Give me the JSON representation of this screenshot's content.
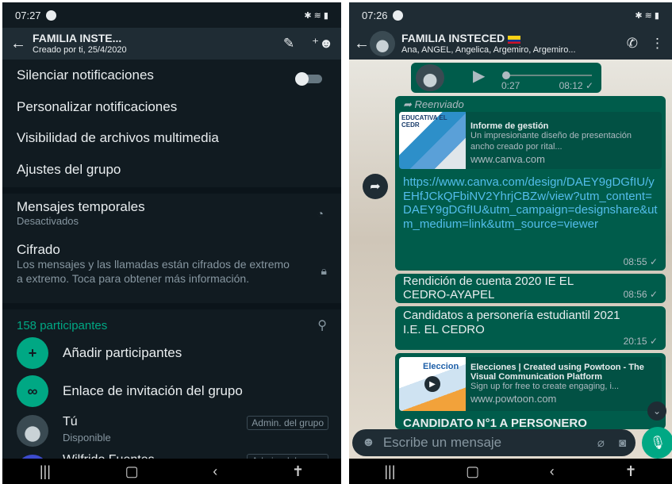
{
  "left": {
    "status": {
      "time": "07:27",
      "icons": "✱ ≋ ▮"
    },
    "header": {
      "title": "FAMILIA INSTE...",
      "subtitle": "Creado por ti, 25/4/2020"
    },
    "menu": {
      "mute": "Silenciar notificaciones",
      "custom_notifications": "Personalizar notificaciones",
      "media_visibility": "Visibilidad de archivos multimedia",
      "group_settings": "Ajustes del grupo",
      "disappearing_title": "Mensajes temporales",
      "disappearing_value": "Desactivados",
      "encryption_title": "Cifrado",
      "encryption_desc": "Los mensajes y las llamadas están cifrados de extremo a extremo. Toca para obtener más información."
    },
    "participants": {
      "count_label": "158 participantes",
      "add_label": "Añadir participantes",
      "invite_label": "Enlace de invitación del grupo",
      "members": [
        {
          "name": "Tú",
          "status": "Disponible",
          "badge": "Admin. del grupo"
        },
        {
          "name": "Wilfrido Fuentes",
          "status": "",
          "badge": "Admin. del grupo"
        }
      ]
    }
  },
  "right": {
    "status": {
      "time": "07:26",
      "icons": "✱ ≋ ▮"
    },
    "header": {
      "title": "FAMILIA INSTECED",
      "flag": "colombia-flag",
      "members": "Ana, ANGEL, Angelica, Argemiro, Argemiro..."
    },
    "voice": {
      "duration": "0:27",
      "time": "08:12 ✓"
    },
    "forwarded_label": "Reenviado",
    "link_msg": {
      "thumb_text": "EDUCATIVA EL CEDR",
      "preview_title": "Informe de gestión",
      "preview_desc": "Un impresionante diseño de presentación ancho creado por rital...",
      "preview_domain": "www.canva.com",
      "url": "https://www.canva.com/design/DAEY9gDGfIU/yEHfJCkQFbiNV2YhrjCBZw/view?utm_content=DAEY9gDGfIU&utm_campaign=designshare&utm_medium=link&utm_source=viewer",
      "time": "08:55 ✓"
    },
    "msg2": {
      "text": "Rendición de cuenta 2020 IE EL CEDRO-AYAPEL",
      "time": "08:56 ✓"
    },
    "msg3": {
      "text": "Candidatos a personería estudiantil 2021 I.E. EL CEDRO",
      "time": "20:15 ✓"
    },
    "msg4": {
      "thumb_text": "Eleccion",
      "preview_title": "Elecciones | Created using Powtoon - The Visual Communication Platform",
      "preview_desc": "Sign up for free to create engaging, i...",
      "preview_domain": "www.powtoon.com",
      "text": "CANDIDATO N°1 A PERSONERO"
    },
    "composer": {
      "placeholder": "Escribe un mensaje"
    }
  },
  "colors": {
    "accent": "#00a884",
    "bubble": "#005c4b",
    "link": "#53bdeb",
    "dark_bg": "#111b21"
  }
}
